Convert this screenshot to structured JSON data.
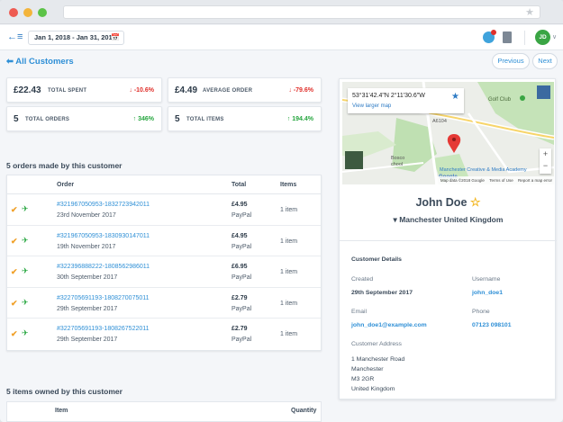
{
  "colors": {
    "accent": "#2e8fd6",
    "negative": "#e0302b",
    "positive": "#26a63f",
    "avatar_bg": "#3aa544",
    "favorite": "#f3b51c"
  },
  "topbar": {
    "menu_icon": "menu-back-icon",
    "date_range": "Jan 1, 2018 - Jan 31, 2018",
    "calendar_icon": "calendar-icon",
    "avatar_initials": "JD"
  },
  "nav": {
    "back_label": "All Customers",
    "previous_label": "Previous",
    "next_label": "Next"
  },
  "stats": [
    {
      "value": "£22.43",
      "label": "TOTAL SPENT",
      "change": "-10.6%",
      "direction": "down"
    },
    {
      "value": "£4.49",
      "label": "AVERAGE ORDER",
      "change": "-79.6%",
      "direction": "down"
    },
    {
      "value": "5",
      "label": "TOTAL ORDERS",
      "change": "346%",
      "direction": "up"
    },
    {
      "value": "5",
      "label": "TOTAL ITEMS",
      "change": "194.4%",
      "direction": "up"
    }
  ],
  "orders": {
    "title": "5 orders made by this customer",
    "columns": {
      "order": "Order",
      "total": "Total",
      "items": "Items"
    },
    "rows": [
      {
        "id": "#321967050953-1832723942011",
        "date": "23rd November 2017",
        "total": "£4.95",
        "payment": "PayPal",
        "items": "1 item"
      },
      {
        "id": "#321967050953-1830930147011",
        "date": "19th November 2017",
        "total": "£4.95",
        "payment": "PayPal",
        "items": "1 item"
      },
      {
        "id": "#322396888222-1808562986011",
        "date": "30th September 2017",
        "total": "£6.95",
        "payment": "PayPal",
        "items": "1 item"
      },
      {
        "id": "#322705691193-1808270075011",
        "date": "29th September 2017",
        "total": "£2.79",
        "payment": "PayPal",
        "items": "1 item"
      },
      {
        "id": "#322705691193-1808267522011",
        "date": "29th September 2017",
        "total": "£2.79",
        "payment": "PayPal",
        "items": "1 item"
      }
    ]
  },
  "owned_items": {
    "title": "5 items owned by this customer",
    "columns": {
      "item": "Item",
      "quantity": "Quantity"
    }
  },
  "map": {
    "coordinates": "53°31'42.4\"N 2°11'30.6\"W",
    "larger_map_label": "View larger map",
    "labels": {
      "golf": "Golf Club",
      "road": "A6104",
      "bosco": "Bosco",
      "school": "chool",
      "academy": "Manchester Creative & Media Academy"
    },
    "logo": "Google",
    "footer": {
      "data": "Map data ©2018 Google",
      "terms": "Terms of Use",
      "report": "Report a map error"
    },
    "zoom_in": "+",
    "zoom_out": "−"
  },
  "customer": {
    "name": "John Doe",
    "location": "Manchester United Kingdom",
    "details_title": "Customer Details",
    "created_label": "Created",
    "created_value": "29th September 2017",
    "username_label": "Username",
    "username_value": "john_doe1",
    "email_label": "Email",
    "email_value": "john_doe1@example.com",
    "phone_label": "Phone",
    "phone_value": "07123 098101",
    "address_label": "Customer Address",
    "address_lines": [
      "1 Manchester Road",
      "Manchester",
      "M3 2GR",
      "United Kingdom"
    ]
  }
}
